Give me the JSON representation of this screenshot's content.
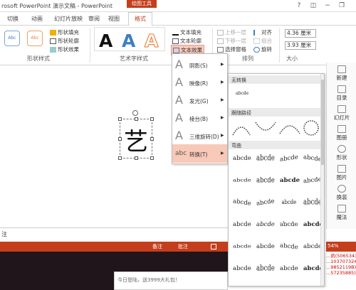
{
  "window": {
    "title": "rosoft PowerPoint 演示文稿 - PowerPoint",
    "context_tab_group": "绘图工具",
    "controls": [
      "?",
      "◫",
      "−",
      "❐"
    ]
  },
  "tabs": [
    "切换",
    "动画",
    "幻灯片放映",
    "审阅",
    "视图"
  ],
  "active_tab": "格式",
  "ribbon": {
    "shape_styles": {
      "group_label": "形状样式",
      "samples": [
        "Abc",
        "Abc"
      ],
      "fill": "形状填充",
      "outline": "形状轮廓",
      "effects": "形状效果"
    },
    "art_styles": {
      "group_label": "艺术字样式",
      "samples": [
        "A",
        "A",
        "A"
      ],
      "text_fill": "文本填充",
      "text_outline": "文本轮廓",
      "text_effects": "文本效果"
    },
    "arrange": {
      "group_label": "排列",
      "bring_forward": "上移一层",
      "send_backward": "下移一层",
      "selection_pane": "选择窗格",
      "align": "对齐",
      "group": "组合",
      "rotate": "旋转"
    },
    "size": {
      "group_label": "大小",
      "height": "4.36 厘米",
      "width": "3.93 厘米"
    }
  },
  "slide": {
    "glyph": "艺"
  },
  "notes_label": "注",
  "status": {
    "notes": "备注",
    "comments": "批注",
    "zoom": "54%"
  },
  "chat": {
    "text": "今日登陆，送3999大礼包！"
  },
  "right_panel": {
    "items": [
      "新建",
      "目录",
      "幻灯片",
      "图册",
      "形状",
      "图片",
      "换装",
      "魔法"
    ]
  },
  "right_log": [
    "...凯(50653436",
    "...1037073244)",
    "...9852119B)",
    "...57235885)"
  ],
  "text_effects_menu": {
    "items": [
      {
        "label": "阴影(S)"
      },
      {
        "label": "映像(R)"
      },
      {
        "label": "发光(G)"
      },
      {
        "label": "棱台(B)"
      },
      {
        "label": "三维旋转(D)"
      },
      {
        "label": "转换(T)",
        "highlighted": true
      }
    ]
  },
  "transform_gallery": {
    "no_transform": {
      "title": "无转换",
      "sample": "abcde"
    },
    "follow_path": {
      "title": "跟随路径"
    },
    "warp": {
      "title": "弯曲",
      "rows": [
        [
          "abcde",
          "abcde",
          "abcde",
          "abcde"
        ],
        [
          "abcde",
          "abcde",
          "abcde",
          "abcde"
        ],
        [
          "abcde",
          "abcde",
          "abcde",
          "abcde"
        ],
        [
          "abcde",
          "abcde",
          "abcde",
          "abcde"
        ],
        [
          "abcde",
          "abcde",
          "abcde",
          "abcde"
        ],
        [
          "abcde",
          "abcde",
          "abcde",
          "abcde"
        ]
      ]
    }
  },
  "colors": {
    "accent": "#c43e1c",
    "highlight": "#f8c8b8",
    "art_blue": "#3f7fc0",
    "art_orange": "#f0a060"
  }
}
